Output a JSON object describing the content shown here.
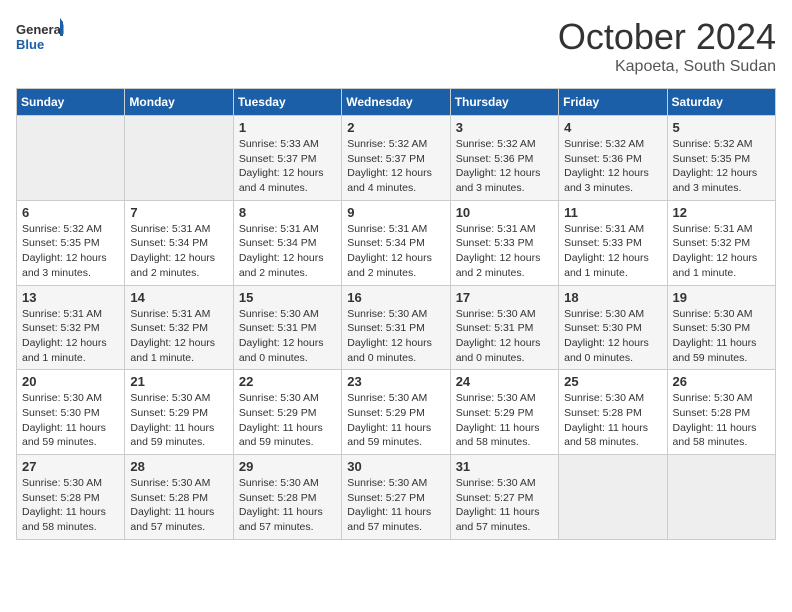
{
  "logo": {
    "line1": "General",
    "line2": "Blue"
  },
  "title": "October 2024",
  "location": "Kapoeta, South Sudan",
  "weekdays": [
    "Sunday",
    "Monday",
    "Tuesday",
    "Wednesday",
    "Thursday",
    "Friday",
    "Saturday"
  ],
  "weeks": [
    [
      {
        "day": "",
        "info": ""
      },
      {
        "day": "",
        "info": ""
      },
      {
        "day": "1",
        "info": "Sunrise: 5:33 AM\nSunset: 5:37 PM\nDaylight: 12 hours and 4 minutes."
      },
      {
        "day": "2",
        "info": "Sunrise: 5:32 AM\nSunset: 5:37 PM\nDaylight: 12 hours and 4 minutes."
      },
      {
        "day": "3",
        "info": "Sunrise: 5:32 AM\nSunset: 5:36 PM\nDaylight: 12 hours and 3 minutes."
      },
      {
        "day": "4",
        "info": "Sunrise: 5:32 AM\nSunset: 5:36 PM\nDaylight: 12 hours and 3 minutes."
      },
      {
        "day": "5",
        "info": "Sunrise: 5:32 AM\nSunset: 5:35 PM\nDaylight: 12 hours and 3 minutes."
      }
    ],
    [
      {
        "day": "6",
        "info": "Sunrise: 5:32 AM\nSunset: 5:35 PM\nDaylight: 12 hours and 3 minutes."
      },
      {
        "day": "7",
        "info": "Sunrise: 5:31 AM\nSunset: 5:34 PM\nDaylight: 12 hours and 2 minutes."
      },
      {
        "day": "8",
        "info": "Sunrise: 5:31 AM\nSunset: 5:34 PM\nDaylight: 12 hours and 2 minutes."
      },
      {
        "day": "9",
        "info": "Sunrise: 5:31 AM\nSunset: 5:34 PM\nDaylight: 12 hours and 2 minutes."
      },
      {
        "day": "10",
        "info": "Sunrise: 5:31 AM\nSunset: 5:33 PM\nDaylight: 12 hours and 2 minutes."
      },
      {
        "day": "11",
        "info": "Sunrise: 5:31 AM\nSunset: 5:33 PM\nDaylight: 12 hours and 1 minute."
      },
      {
        "day": "12",
        "info": "Sunrise: 5:31 AM\nSunset: 5:32 PM\nDaylight: 12 hours and 1 minute."
      }
    ],
    [
      {
        "day": "13",
        "info": "Sunrise: 5:31 AM\nSunset: 5:32 PM\nDaylight: 12 hours and 1 minute."
      },
      {
        "day": "14",
        "info": "Sunrise: 5:31 AM\nSunset: 5:32 PM\nDaylight: 12 hours and 1 minute."
      },
      {
        "day": "15",
        "info": "Sunrise: 5:30 AM\nSunset: 5:31 PM\nDaylight: 12 hours and 0 minutes."
      },
      {
        "day": "16",
        "info": "Sunrise: 5:30 AM\nSunset: 5:31 PM\nDaylight: 12 hours and 0 minutes."
      },
      {
        "day": "17",
        "info": "Sunrise: 5:30 AM\nSunset: 5:31 PM\nDaylight: 12 hours and 0 minutes."
      },
      {
        "day": "18",
        "info": "Sunrise: 5:30 AM\nSunset: 5:30 PM\nDaylight: 12 hours and 0 minutes."
      },
      {
        "day": "19",
        "info": "Sunrise: 5:30 AM\nSunset: 5:30 PM\nDaylight: 11 hours and 59 minutes."
      }
    ],
    [
      {
        "day": "20",
        "info": "Sunrise: 5:30 AM\nSunset: 5:30 PM\nDaylight: 11 hours and 59 minutes."
      },
      {
        "day": "21",
        "info": "Sunrise: 5:30 AM\nSunset: 5:29 PM\nDaylight: 11 hours and 59 minutes."
      },
      {
        "day": "22",
        "info": "Sunrise: 5:30 AM\nSunset: 5:29 PM\nDaylight: 11 hours and 59 minutes."
      },
      {
        "day": "23",
        "info": "Sunrise: 5:30 AM\nSunset: 5:29 PM\nDaylight: 11 hours and 59 minutes."
      },
      {
        "day": "24",
        "info": "Sunrise: 5:30 AM\nSunset: 5:29 PM\nDaylight: 11 hours and 58 minutes."
      },
      {
        "day": "25",
        "info": "Sunrise: 5:30 AM\nSunset: 5:28 PM\nDaylight: 11 hours and 58 minutes."
      },
      {
        "day": "26",
        "info": "Sunrise: 5:30 AM\nSunset: 5:28 PM\nDaylight: 11 hours and 58 minutes."
      }
    ],
    [
      {
        "day": "27",
        "info": "Sunrise: 5:30 AM\nSunset: 5:28 PM\nDaylight: 11 hours and 58 minutes."
      },
      {
        "day": "28",
        "info": "Sunrise: 5:30 AM\nSunset: 5:28 PM\nDaylight: 11 hours and 57 minutes."
      },
      {
        "day": "29",
        "info": "Sunrise: 5:30 AM\nSunset: 5:28 PM\nDaylight: 11 hours and 57 minutes."
      },
      {
        "day": "30",
        "info": "Sunrise: 5:30 AM\nSunset: 5:27 PM\nDaylight: 11 hours and 57 minutes."
      },
      {
        "day": "31",
        "info": "Sunrise: 5:30 AM\nSunset: 5:27 PM\nDaylight: 11 hours and 57 minutes."
      },
      {
        "day": "",
        "info": ""
      },
      {
        "day": "",
        "info": ""
      }
    ]
  ]
}
